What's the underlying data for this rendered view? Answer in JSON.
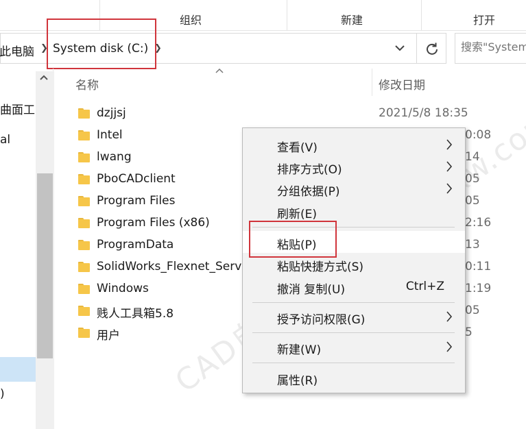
{
  "ribbon": {
    "groups": [
      "组织",
      "新建",
      "打开"
    ]
  },
  "address": {
    "crumbs": [
      "此电脑",
      "System disk (C:)"
    ],
    "refresh_icon": "refresh-icon",
    "dropdown_icon": "chevron-down-icon"
  },
  "search": {
    "placeholder": "搜索\"System disk (C:)\""
  },
  "nav": {
    "items": [
      "曲面工",
      "al",
      ")"
    ]
  },
  "columns": {
    "name": "名称",
    "date": "修改日期"
  },
  "files": [
    {
      "name": "dzjjsj",
      "date": "2021/5/8 18:35"
    },
    {
      "name": "Intel",
      "date": "0:08"
    },
    {
      "name": "lwang",
      "date": "14"
    },
    {
      "name": "PboCADclient",
      "date": "05"
    },
    {
      "name": "Program Files",
      "date": "05"
    },
    {
      "name": "Program Files (x86)",
      "date": "2:16"
    },
    {
      "name": "ProgramData",
      "date": "13"
    },
    {
      "name": "SolidWorks_Flexnet_Serv",
      "date": "0:11"
    },
    {
      "name": "Windows",
      "date": "1:19"
    },
    {
      "name": "贱人工具箱5.8",
      "date": "05"
    },
    {
      "name": "用户",
      "date": "5"
    }
  ],
  "menu": {
    "view": "查看(V)",
    "sort": "排序方式(O)",
    "group": "分组依据(P)",
    "refresh": "刷新(E)",
    "paste": "粘贴(P)",
    "paste_shortcut": "粘贴快捷方式(S)",
    "undo": "撤消 复制(U)",
    "undo_shortcut": "Ctrl+Z",
    "access": "授予访问权限(G)",
    "new": "新建(W)",
    "properties": "属性(R)"
  },
  "watermark": "CAD自学网 www.cadzxw.com",
  "colors": {
    "highlight_box": "#d0343b",
    "folder": "#f6c649",
    "selection": "#cde4f7",
    "menu_bg": "#f2f2f2"
  }
}
